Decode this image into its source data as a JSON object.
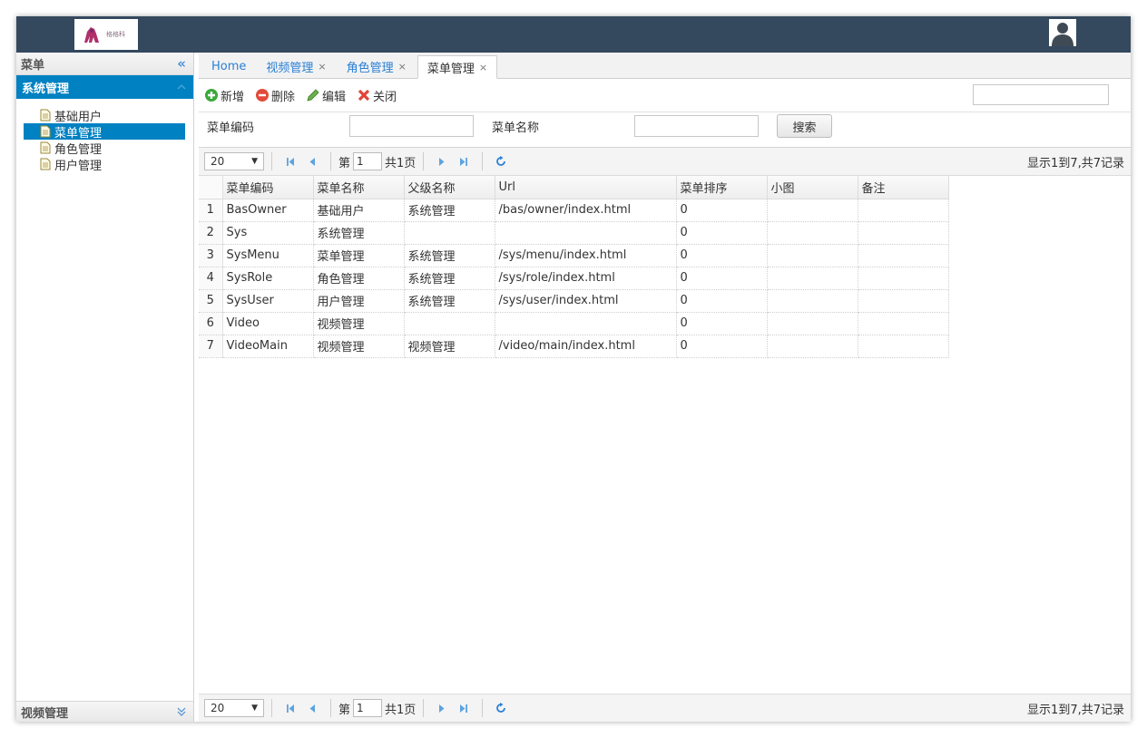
{
  "header": {
    "logo_text": "格格科",
    "colors": {
      "topbar": "#34495e",
      "accent": "#0081c2"
    }
  },
  "sidebar": {
    "title": "菜单",
    "group": "系统管理",
    "items": [
      {
        "label": "基础用户",
        "selected": false
      },
      {
        "label": "菜单管理",
        "selected": true
      },
      {
        "label": "角色管理",
        "selected": false
      },
      {
        "label": "用户管理",
        "selected": false
      }
    ],
    "footer_group": "视频管理"
  },
  "tabs": [
    {
      "label": "Home",
      "closable": false,
      "active": false
    },
    {
      "label": "视频管理",
      "closable": true,
      "active": false
    },
    {
      "label": "角色管理",
      "closable": true,
      "active": false
    },
    {
      "label": "菜单管理",
      "closable": true,
      "active": true
    }
  ],
  "toolbar": {
    "add": "新增",
    "delete": "删除",
    "edit": "编辑",
    "close": "关闭",
    "close_x": "×"
  },
  "filter": {
    "code_label": "菜单编码",
    "name_label": "菜单名称",
    "search_button": "搜索"
  },
  "pager": {
    "page_size": "20",
    "page_prefix": "第",
    "page_number": "1",
    "page_suffix": "共1页",
    "info": "显示1到7,共7记录"
  },
  "grid": {
    "columns": [
      "菜单编码",
      "菜单名称",
      "父级名称",
      "Url",
      "菜单排序",
      "小图",
      "备注"
    ],
    "rows": [
      [
        "1",
        "BasOwner",
        "基础用户",
        "系统管理",
        "/bas/owner/index.html",
        "0",
        "",
        ""
      ],
      [
        "2",
        "Sys",
        "系统管理",
        "",
        "",
        "0",
        "",
        ""
      ],
      [
        "3",
        "SysMenu",
        "菜单管理",
        "系统管理",
        "/sys/menu/index.html",
        "0",
        "",
        ""
      ],
      [
        "4",
        "SysRole",
        "角色管理",
        "系统管理",
        "/sys/role/index.html",
        "0",
        "",
        ""
      ],
      [
        "5",
        "SysUser",
        "用户管理",
        "系统管理",
        "/sys/user/index.html",
        "0",
        "",
        ""
      ],
      [
        "6",
        "Video",
        "视频管理",
        "",
        "",
        "0",
        "",
        ""
      ],
      [
        "7",
        "VideoMain",
        "视频管理",
        "视频管理",
        "/video/main/index.html",
        "0",
        "",
        ""
      ]
    ]
  }
}
